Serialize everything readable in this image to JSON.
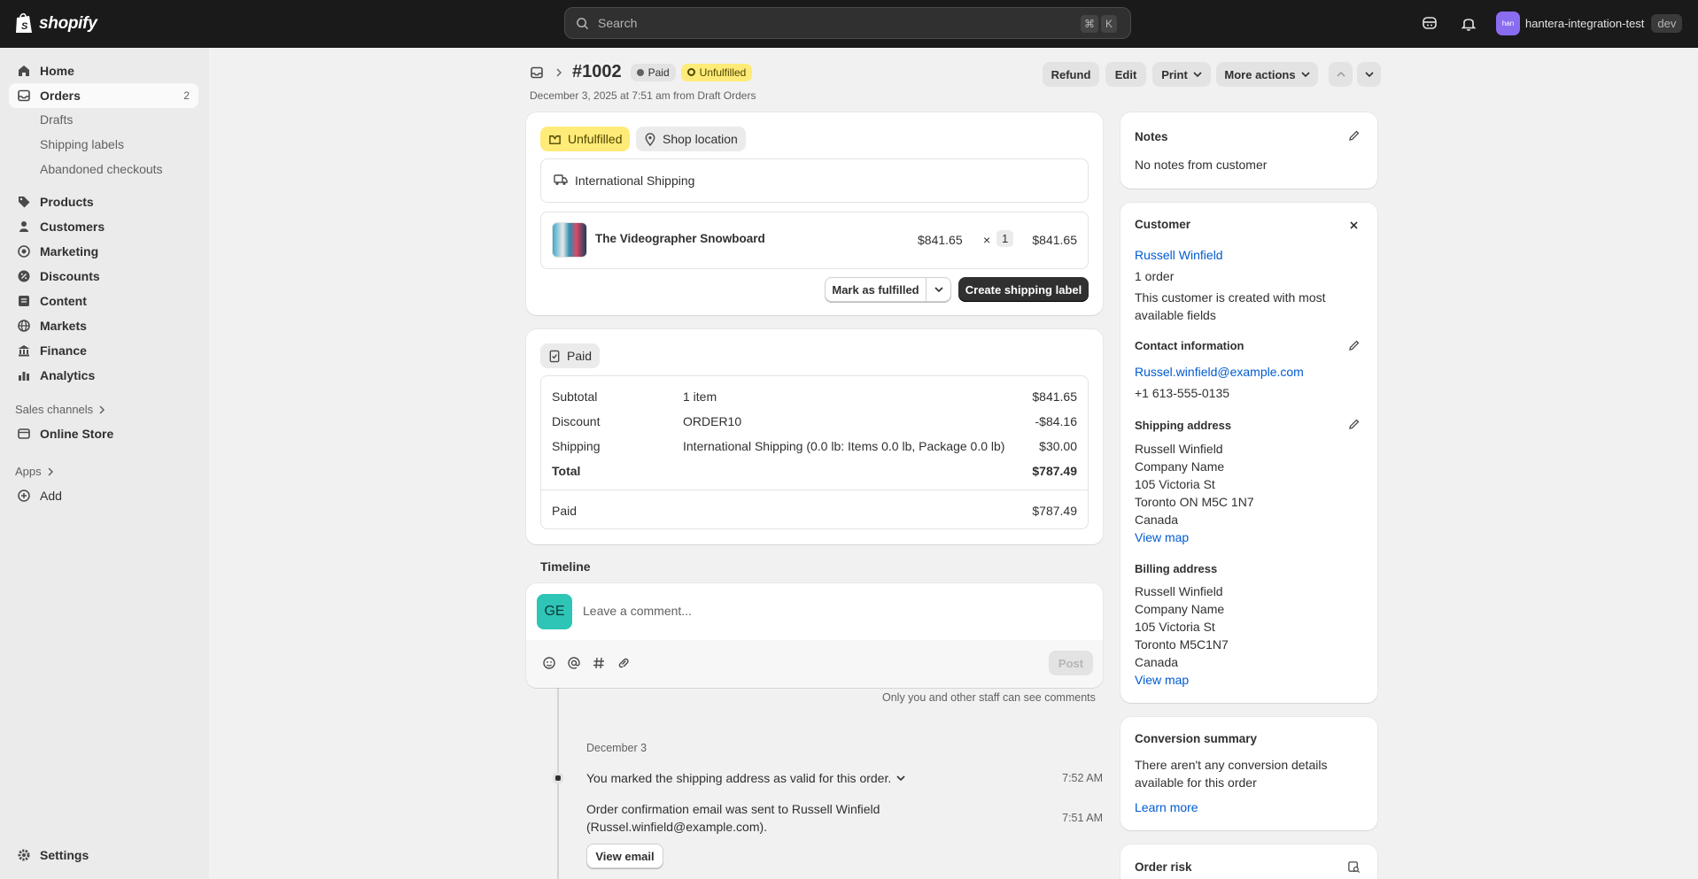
{
  "topbar": {
    "brand": "shopify",
    "search_placeholder": "Search",
    "kbd1": "⌘",
    "kbd2": "K",
    "store_initials": "han",
    "store_name": "hantera-integration-test",
    "env_badge": "dev"
  },
  "sidebar": {
    "home": "Home",
    "orders": "Orders",
    "orders_count": "2",
    "drafts": "Drafts",
    "shipping_labels": "Shipping labels",
    "abandoned": "Abandoned checkouts",
    "products": "Products",
    "customers": "Customers",
    "marketing": "Marketing",
    "discounts": "Discounts",
    "content": "Content",
    "markets": "Markets",
    "finance": "Finance",
    "analytics": "Analytics",
    "sales_channels": "Sales channels",
    "online_store": "Online Store",
    "apps": "Apps",
    "add": "Add",
    "settings": "Settings"
  },
  "header": {
    "order_number": "#1002",
    "payment_badge": "Paid",
    "fulfillment_badge": "Unfulfilled",
    "subtitle": "December 3, 2025 at 7:51 am from Draft Orders",
    "refund": "Refund",
    "edit": "Edit",
    "print": "Print",
    "more_actions": "More actions"
  },
  "fulfillment": {
    "status_pill": "Unfulfilled",
    "location_pill": "Shop location",
    "shipping_method": "International Shipping",
    "product_name": "The Videographer Snowboard",
    "unit_price": "$841.65",
    "times": "×",
    "quantity": "1",
    "line_total": "$841.65",
    "mark_fulfilled": "Mark as fulfilled",
    "create_label": "Create shipping label"
  },
  "payment": {
    "status_pill": "Paid",
    "rows": [
      {
        "label": "Subtotal",
        "detail": "1 item",
        "amount": "$841.65"
      },
      {
        "label": "Discount",
        "detail": "ORDER10",
        "amount": "-$84.16"
      },
      {
        "label": "Shipping",
        "detail": "International Shipping (0.0 lb: Items 0.0 lb, Package 0.0 lb)",
        "amount": "$30.00"
      }
    ],
    "total_label": "Total",
    "total_amount": "$787.49",
    "paid_label": "Paid",
    "paid_amount": "$787.49"
  },
  "timeline": {
    "heading": "Timeline",
    "avatar_initials": "GE",
    "comment_placeholder": "Leave a comment...",
    "post": "Post",
    "staff_note": "Only you and other staff can see comments",
    "date_heading": "December 3",
    "events": [
      {
        "text": "You marked the shipping address as valid for this order.",
        "time": "7:52 AM"
      },
      {
        "text": "Order confirmation email was sent to Russell Winfield",
        "text2": "(Russel.winfield@example.com).",
        "time": "7:51 AM"
      }
    ],
    "view_email": "View email"
  },
  "notes": {
    "heading": "Notes",
    "body": "No notes from customer"
  },
  "customer": {
    "heading": "Customer",
    "name": "Russell Winfield",
    "orders": "1 order",
    "description_line1": "This customer is created with most",
    "description_line2": "available fields",
    "contact_heading": "Contact information",
    "email": "Russel.winfield@example.com",
    "phone": "+1 613-555-0135",
    "shipping_heading": "Shipping address",
    "shipping_lines": [
      "Russell Winfield",
      "Company Name",
      "105 Victoria St",
      "Toronto ON M5C 1N7",
      "Canada"
    ],
    "view_map": "View map",
    "billing_heading": "Billing address",
    "billing_lines": [
      "Russell Winfield",
      "Company Name",
      "105 Victoria St",
      "Toronto M5C1N7",
      "Canada"
    ]
  },
  "conversion": {
    "heading": "Conversion summary",
    "line1": "There aren't any conversion details",
    "line2": "available for this order",
    "learn_more": "Learn more"
  },
  "risk": {
    "heading": "Order risk"
  },
  "colors": {
    "topbar": "#1a1a1a",
    "badge_yellow": "#ffeb78",
    "link": "#005bd3",
    "primary_button": "#303030"
  }
}
